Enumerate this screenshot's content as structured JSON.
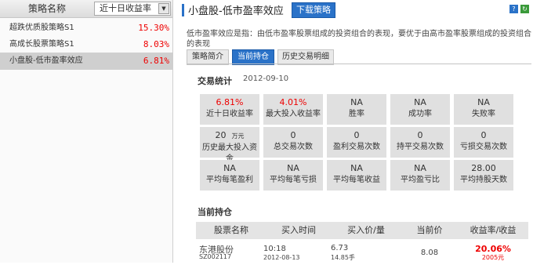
{
  "left_panel": {
    "header": {
      "col_name": "策略名称",
      "col_sort": "近十日收益率"
    },
    "rows": [
      {
        "name": "超跌优质股策略S1",
        "value": "15.30%"
      },
      {
        "name": "高成长股票策略S1",
        "value": "8.03%"
      },
      {
        "name": "小盘股-低市盈率效应",
        "value": "6.81%"
      }
    ]
  },
  "right_panel": {
    "title": "小盘股-低市盈率效应",
    "download_button": "下载策略",
    "description": "低市盈率效应是指：由低市盈率股票组成的投资组合的表现，要优于由高市盈率股票组成的投资组合的表现",
    "tabs": [
      "策略简介",
      "当前持仓",
      "历史交易明细"
    ],
    "stats": {
      "title": "交易统计",
      "date": "2012-09-10",
      "rows": [
        [
          {
            "value": "6.81%",
            "label": "近十日收益率",
            "red": true
          },
          {
            "value": "4.01%",
            "label": "最大投入收益率",
            "red": true
          },
          {
            "value": "NA",
            "label": "胜率"
          },
          {
            "value": "NA",
            "label": "成功率"
          },
          {
            "value": "NA",
            "label": "失败率"
          }
        ],
        [
          {
            "value": "20",
            "unit": "万元",
            "label": "历史最大投入资金"
          },
          {
            "value": "0",
            "label": "总交易次数"
          },
          {
            "value": "0",
            "label": "盈利交易次数"
          },
          {
            "value": "0",
            "label": "持平交易次数"
          },
          {
            "value": "0",
            "label": "亏损交易次数"
          }
        ],
        [
          {
            "value": "NA",
            "label": "平均每笔盈利"
          },
          {
            "value": "NA",
            "label": "平均每笔亏损"
          },
          {
            "value": "NA",
            "label": "平均每笔收益"
          },
          {
            "value": "NA",
            "label": "平均盈亏比"
          },
          {
            "value": "28.00",
            "label": "平均持股天数"
          }
        ]
      ]
    },
    "holdings": {
      "title": "当前持仓",
      "columns": [
        "股票名称",
        "买入时间",
        "买入价/量",
        "当前价",
        "收益率/收益"
      ],
      "rows": [
        {
          "name": "东港股份",
          "code": "SZ002117",
          "buy_time": "10:18",
          "buy_date": "2012-08-13",
          "buy_price": "6.73",
          "buy_volume": "14.85手",
          "current_price": "8.08",
          "return_rate": "20.06%",
          "return_amount": "2005元"
        }
      ]
    }
  },
  "colors": {
    "accent": "#2a72c8",
    "up": "#e00000",
    "cell_bg": "#e0e0e0"
  },
  "icons": [
    "help-icon",
    "refresh-icon",
    "sort-dropdown-icon"
  ]
}
